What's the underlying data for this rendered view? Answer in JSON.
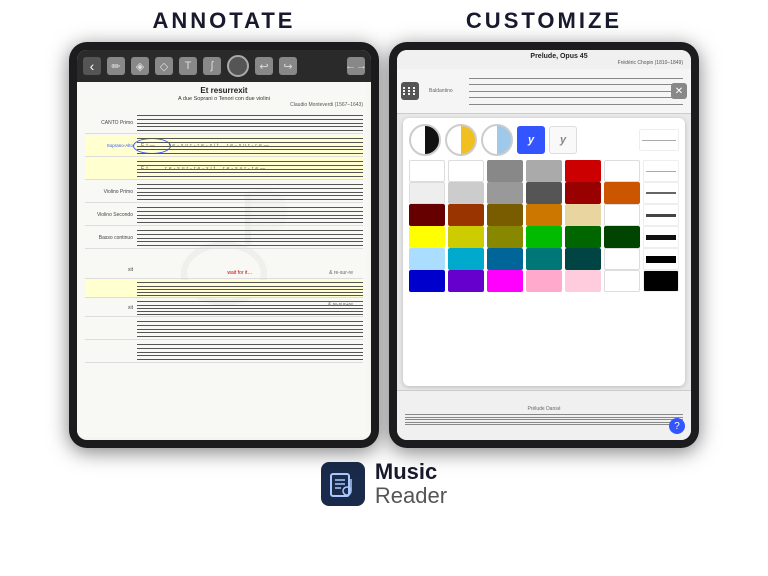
{
  "page": {
    "background": "#ffffff",
    "sections": {
      "left_title": "ANNOTATE",
      "right_title": "CUSTOMIZE"
    }
  },
  "left_tablet": {
    "score_title": "Et resurrexit",
    "score_subtitle": "A due Soprani o Tenori con due violini",
    "score_composer": "Claudio Monteverdi (1567–1643)",
    "staff_rows": [
      {
        "label": "CANTO Primo",
        "highlighted": false
      },
      {
        "label": "Soprano-Alto",
        "highlighted": true,
        "has_oval": true
      },
      {
        "label": "",
        "highlighted": true
      },
      {
        "label": "Violino Primo",
        "highlighted": false
      },
      {
        "label": "Violino Secondo",
        "highlighted": false
      },
      {
        "label": "Basso continuo",
        "highlighted": false
      }
    ],
    "bottom_rows": [
      {
        "has_red": true,
        "red_text": "wait for it…"
      },
      {
        "highlighted": true
      },
      {
        "highlighted": false
      },
      {
        "highlighted": false
      },
      {
        "highlighted": false
      }
    ]
  },
  "right_tablet": {
    "score_title": "Prelude, Opus 45",
    "score_composer": "Frédéric Chopin (1810–1849)",
    "pen_swatches": [
      {
        "type": "half-black",
        "label": "black-white swatch"
      },
      {
        "type": "half-yellow",
        "label": "yellow-white swatch"
      },
      {
        "type": "half-blue",
        "label": "blue-white swatch"
      }
    ],
    "y_buttons": [
      {
        "label": "y",
        "active": true
      },
      {
        "label": "y",
        "active": false
      }
    ],
    "color_rows": [
      [
        "#ffffff",
        "#ffffff",
        "#888888",
        "#aaaaaa",
        "#cc0000",
        "#ffffff",
        "line-thin"
      ],
      [
        "#ffffff",
        "#cccccc",
        "#999999",
        "#555555",
        "#990000",
        "#cc6600",
        "line-medium"
      ],
      [
        "#660000",
        "#993300",
        "#7a5c00",
        "#cc7700",
        "#e8d5a0",
        "#ffffff",
        "line-medium"
      ],
      [
        "#ffff00",
        "#cccc00",
        "#888800",
        "#00bb00",
        "#006600",
        "#004400",
        "line-thick"
      ],
      [
        "#aaddff",
        "#00aacc",
        "#006699",
        "#007777",
        "#004444",
        "#ffffff",
        "line-thick"
      ],
      [
        "#0000cc",
        "#6600cc",
        "#ff00ff",
        "#ffaacc",
        "#ffccdd",
        "#ffffff",
        "line-xl"
      ]
    ]
  },
  "logo": {
    "app_name_line1": "Music",
    "app_name_line2": "Reader"
  }
}
